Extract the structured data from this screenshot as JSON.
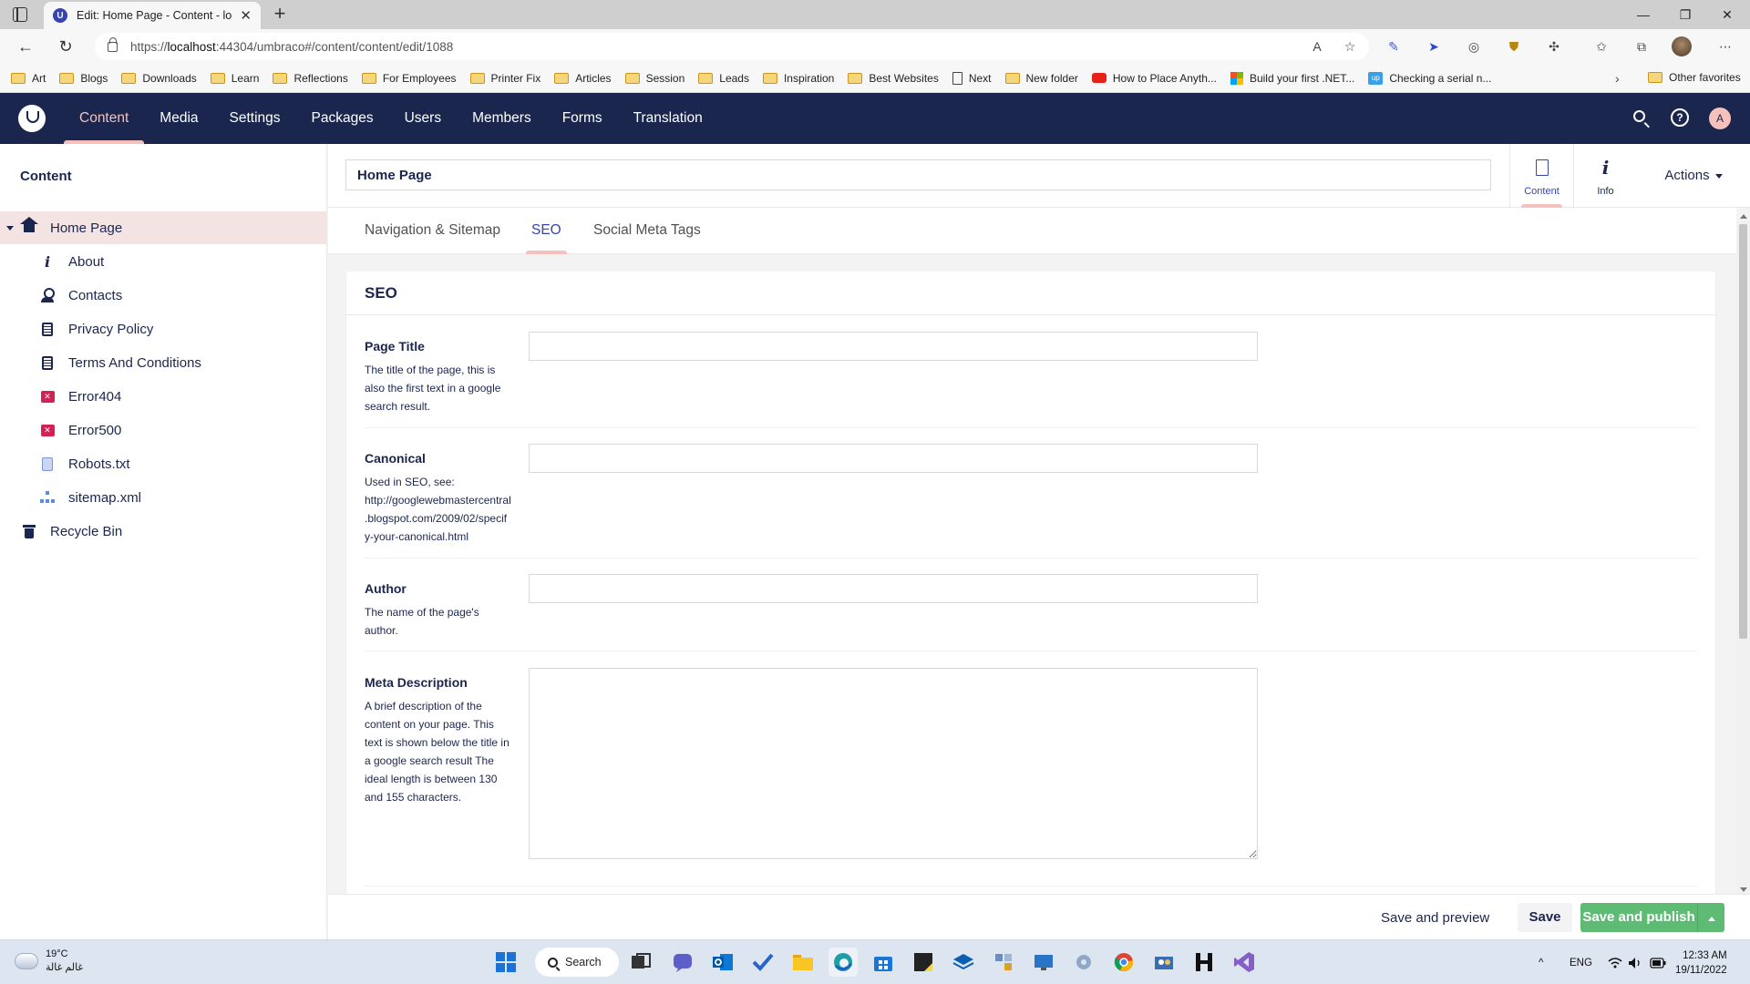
{
  "browser": {
    "tab_title": "Edit: Home Page - Content - loca",
    "new_tab": "+",
    "url_scheme": "https://",
    "url_host": "localhost",
    "url_rest": ":44304/umbraco#/content/content/edit/1088",
    "bookmarks": [
      {
        "label": "Art",
        "icon": "folder-icon"
      },
      {
        "label": "Blogs",
        "icon": "folder-icon"
      },
      {
        "label": "Downloads",
        "icon": "folder-icon"
      },
      {
        "label": "Learn",
        "icon": "folder-icon"
      },
      {
        "label": "Reflections",
        "icon": "folder-icon"
      },
      {
        "label": "For Employees",
        "icon": "folder-icon"
      },
      {
        "label": "Printer Fix",
        "icon": "folder-icon"
      },
      {
        "label": "Articles",
        "icon": "folder-icon"
      },
      {
        "label": "Session",
        "icon": "folder-icon"
      },
      {
        "label": "Leads",
        "icon": "folder-icon"
      },
      {
        "label": "Inspiration",
        "icon": "folder-icon"
      },
      {
        "label": "Best Websites",
        "icon": "folder-icon"
      },
      {
        "label": "Next",
        "icon": "page-icon"
      },
      {
        "label": "New folder",
        "icon": "folder-icon"
      },
      {
        "label": "How to Place Anyth...",
        "icon": "youtube-icon"
      },
      {
        "label": "Build your first .NET...",
        "icon": "microsoft-icon"
      },
      {
        "label": "Checking a serial n...",
        "icon": "upwork-icon"
      }
    ],
    "other_favorites": "Other favorites"
  },
  "header": {
    "nav": [
      "Content",
      "Media",
      "Settings",
      "Packages",
      "Users",
      "Members",
      "Forms",
      "Translation"
    ],
    "active_nav": "Content",
    "user_initial": "A"
  },
  "sidebar": {
    "title": "Content",
    "tree": [
      {
        "label": "Home Page",
        "icon": "home-icon"
      },
      {
        "label": "About",
        "icon": "info-icon"
      },
      {
        "label": "Contacts",
        "icon": "contact-icon"
      },
      {
        "label": "Privacy Policy",
        "icon": "document-icon"
      },
      {
        "label": "Terms And Conditions",
        "icon": "document-icon"
      },
      {
        "label": "Error404",
        "icon": "error-page-icon"
      },
      {
        "label": "Error500",
        "icon": "error-page-icon"
      },
      {
        "label": "Robots.txt",
        "icon": "text-file-icon"
      },
      {
        "label": "sitemap.xml",
        "icon": "sitemap-icon"
      },
      {
        "label": "Recycle Bin",
        "icon": "trash-icon"
      }
    ]
  },
  "editor": {
    "node_name": "Home Page",
    "apps": [
      {
        "label": "Content",
        "icon": "page-icon"
      },
      {
        "label": "Info",
        "icon": "info-icon"
      }
    ],
    "actions_label": "Actions",
    "tabs": [
      "Navigation & Sitemap",
      "SEO",
      "Social Meta Tags"
    ],
    "active_tab": "SEO",
    "group_title": "SEO",
    "properties": [
      {
        "label": "Page Title",
        "description": "The title of the page, this is also the first text in a google search result.",
        "value": ""
      },
      {
        "label": "Canonical",
        "description": "Used in SEO, see: http://googlewebmastercentral.blogspot.com/2009/02/specify-your-canonical.html",
        "value": ""
      },
      {
        "label": "Author",
        "description": "The name of the page's author.",
        "value": ""
      },
      {
        "label": "Meta Description",
        "description": "A brief description of the content on your page. This text is shown below the title in a google search result The ideal length is between 130 and 155 characters.",
        "value": ""
      }
    ]
  },
  "footer": {
    "save_preview": "Save and preview",
    "save": "Save",
    "save_publish": "Save and publish"
  },
  "taskbar": {
    "temperature": "19°C",
    "weather_note": "غالم غالة",
    "search_label": "Search",
    "language": "ENG",
    "time": "12:33 AM",
    "date": "19/11/2022"
  },
  "colors": {
    "umbraco_navy": "#1b264f",
    "accent_pink": "#f5c1bc",
    "publish_green": "#5dbb73",
    "error_red": "#d42054",
    "selected_row": "#f3e4e3"
  }
}
